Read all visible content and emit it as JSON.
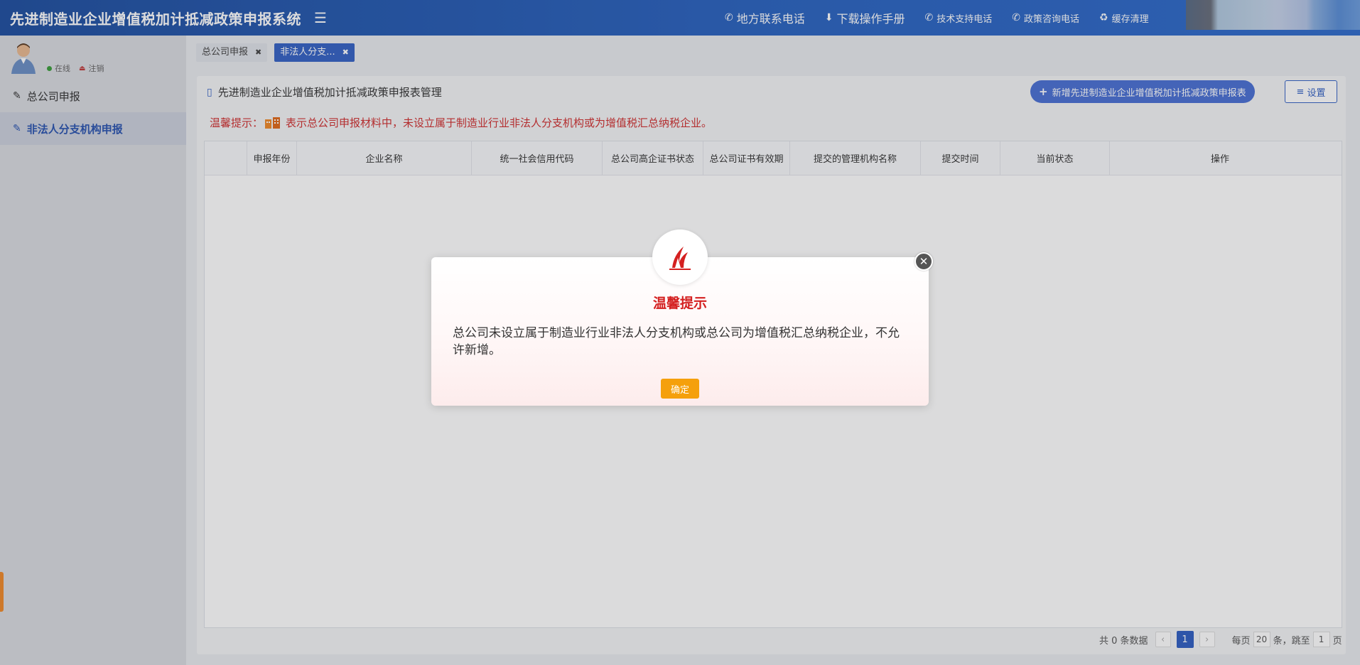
{
  "header": {
    "app_title": "先进制造业企业增值税加计抵减政策申报系统",
    "links": [
      {
        "label": "地方联系电话",
        "icon": "phone-icon"
      },
      {
        "label": "下载操作手册",
        "icon": "download-icon"
      },
      {
        "label": "技术支持电话",
        "icon": "phone-icon"
      },
      {
        "label": "政策咨询电话",
        "icon": "phone-icon"
      },
      {
        "label": "缓存清理",
        "icon": "recycle-icon"
      }
    ]
  },
  "user": {
    "online_label": "在线",
    "logout_label": "注销"
  },
  "sidebar": {
    "items": [
      {
        "label": "总公司申报",
        "icon": "edit-icon",
        "active": false
      },
      {
        "label": "非法人分支机构申报",
        "icon": "edit-icon",
        "active": true
      }
    ]
  },
  "tabs": [
    {
      "label": "总公司申报",
      "active": false
    },
    {
      "label": "非法人分支...",
      "active": true
    }
  ],
  "panel": {
    "title": "先进制造业企业增值税加计抵减政策申报表管理",
    "add_button": "新增先进制造业企业增值税加计抵减政策申报表",
    "settings_button": "设置",
    "hint_prefix": "温馨提示：",
    "hint_text": "表示总公司申报材料中，未设立属于制造业行业非法人分支机构或为增值税汇总纳税企业。"
  },
  "table": {
    "columns": [
      "申报年份",
      "企业名称",
      "统一社会信用代码",
      "总公司高企证书状态",
      "总公司证书有效期",
      "提交的管理机构名称",
      "提交时间",
      "当前状态",
      "操作"
    ],
    "rows": []
  },
  "pagination": {
    "total_text": "共 0 条数据",
    "current_page": "1",
    "per_page_prefix": "每页",
    "per_page_value": "20",
    "per_page_suffix": "条，跳至",
    "jump_value": "1",
    "page_suffix": "页"
  },
  "modal": {
    "title": "温馨提示",
    "message": "总公司未设立属于制造业行业非法人分支机构或总公司为增值税汇总纳税企业，不允许新增。",
    "ok_button": "确定"
  },
  "colors": {
    "header_bg": "#2a5db8",
    "accent": "#3462c4",
    "hint_red": "#d03030",
    "modal_title_red": "#d42020",
    "ok_button": "#f5a00c"
  }
}
